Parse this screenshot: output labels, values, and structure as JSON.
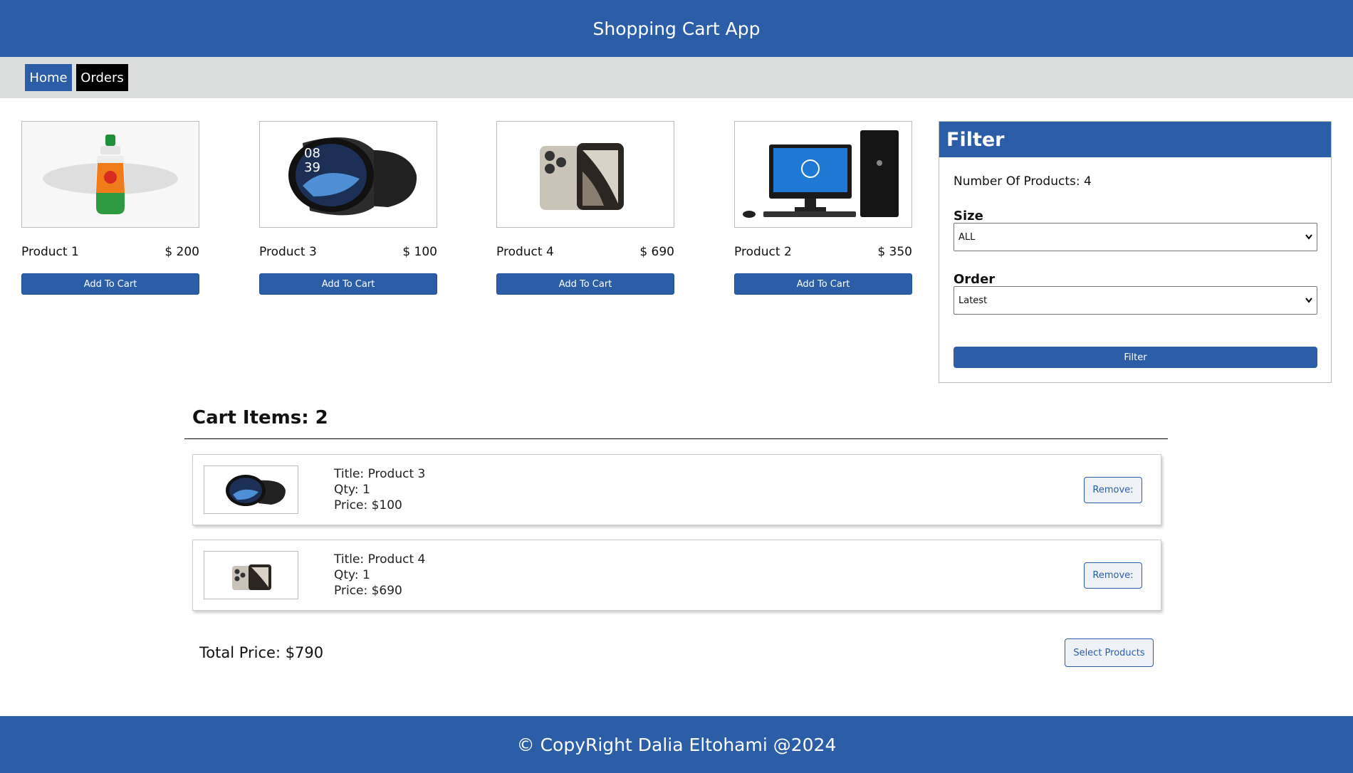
{
  "header": {
    "title": "Shopping Cart App"
  },
  "nav": {
    "home_label": "Home",
    "orders_label": "Orders"
  },
  "products": [
    {
      "name": "Product 1",
      "price": "$ 200",
      "image_icon": "bottle-icon",
      "button_label": "Add To Cart"
    },
    {
      "name": "Product 3",
      "price": "$ 100",
      "image_icon": "smartwatch-icon",
      "button_label": "Add To Cart"
    },
    {
      "name": "Product 4",
      "price": "$ 690",
      "image_icon": "smartphone-icon",
      "button_label": "Add To Cart"
    },
    {
      "name": "Product 2",
      "price": "$ 350",
      "image_icon": "desktop-computer-icon",
      "button_label": "Add To Cart"
    }
  ],
  "filter": {
    "title": "Filter",
    "count_text": "Number Of Products: 4",
    "size_label": "Size",
    "size_value": "ALL",
    "order_label": "Order",
    "order_value": "Latest",
    "button_label": "Filter"
  },
  "cart": {
    "title": "Cart Items: 2",
    "items": [
      {
        "title": "Title: Product 3",
        "qty": "Qty: 1",
        "price": "Price: $100",
        "remove_label": "Remove:",
        "image_icon": "smartwatch-icon"
      },
      {
        "title": "Title: Product 4",
        "qty": "Qty: 1",
        "price": "Price: $690",
        "remove_label": "Remove:",
        "image_icon": "smartphone-icon"
      }
    ],
    "total": "Total Price: $790",
    "select_label": "Select Products"
  },
  "footer": {
    "text": "© CopyRight Dalia Eltohami @2024"
  },
  "colors": {
    "primary": "#2b5ea7",
    "nav_bg": "#dcdddd",
    "orders_bg": "#000000"
  }
}
